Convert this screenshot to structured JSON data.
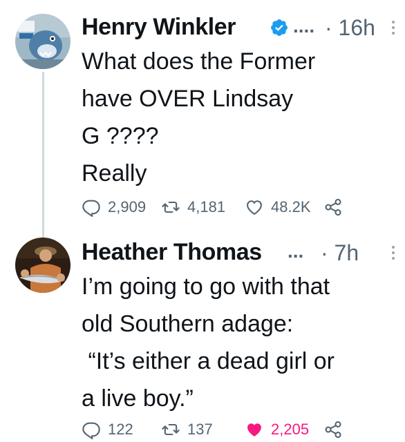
{
  "tweets": [
    {
      "author": "Henry Winkler",
      "verified": true,
      "ellipsis": "....",
      "time": "· 16h",
      "lines": [
        "What does the Former",
        "have OVER Lindsay",
        "G ????",
        "Really"
      ],
      "replies": "2,909",
      "retweets": "4,181",
      "likes": "48.2K",
      "liked": false
    },
    {
      "author": "Heather Thomas",
      "verified": false,
      "ellipsis": "...",
      "time": "· 7h",
      "lines": [
        "I’m going to go with that",
        "old Southern adage:",
        " “It’s either a dead girl or",
        "a live boy.”"
      ],
      "replies": "122",
      "retweets": "137",
      "likes": "2,205",
      "liked": true
    }
  ],
  "icons": {
    "reply": "reply-icon",
    "retweet": "retweet-icon",
    "like": "heart-icon",
    "share": "share-icon",
    "verified": "verified-badge-icon",
    "more": "more-vertical-icon"
  },
  "colors": {
    "text": "#0f1419",
    "secondary": "#536471",
    "verified": "#1d9bf0",
    "like": "#f91880",
    "thread": "#cfd9de"
  }
}
